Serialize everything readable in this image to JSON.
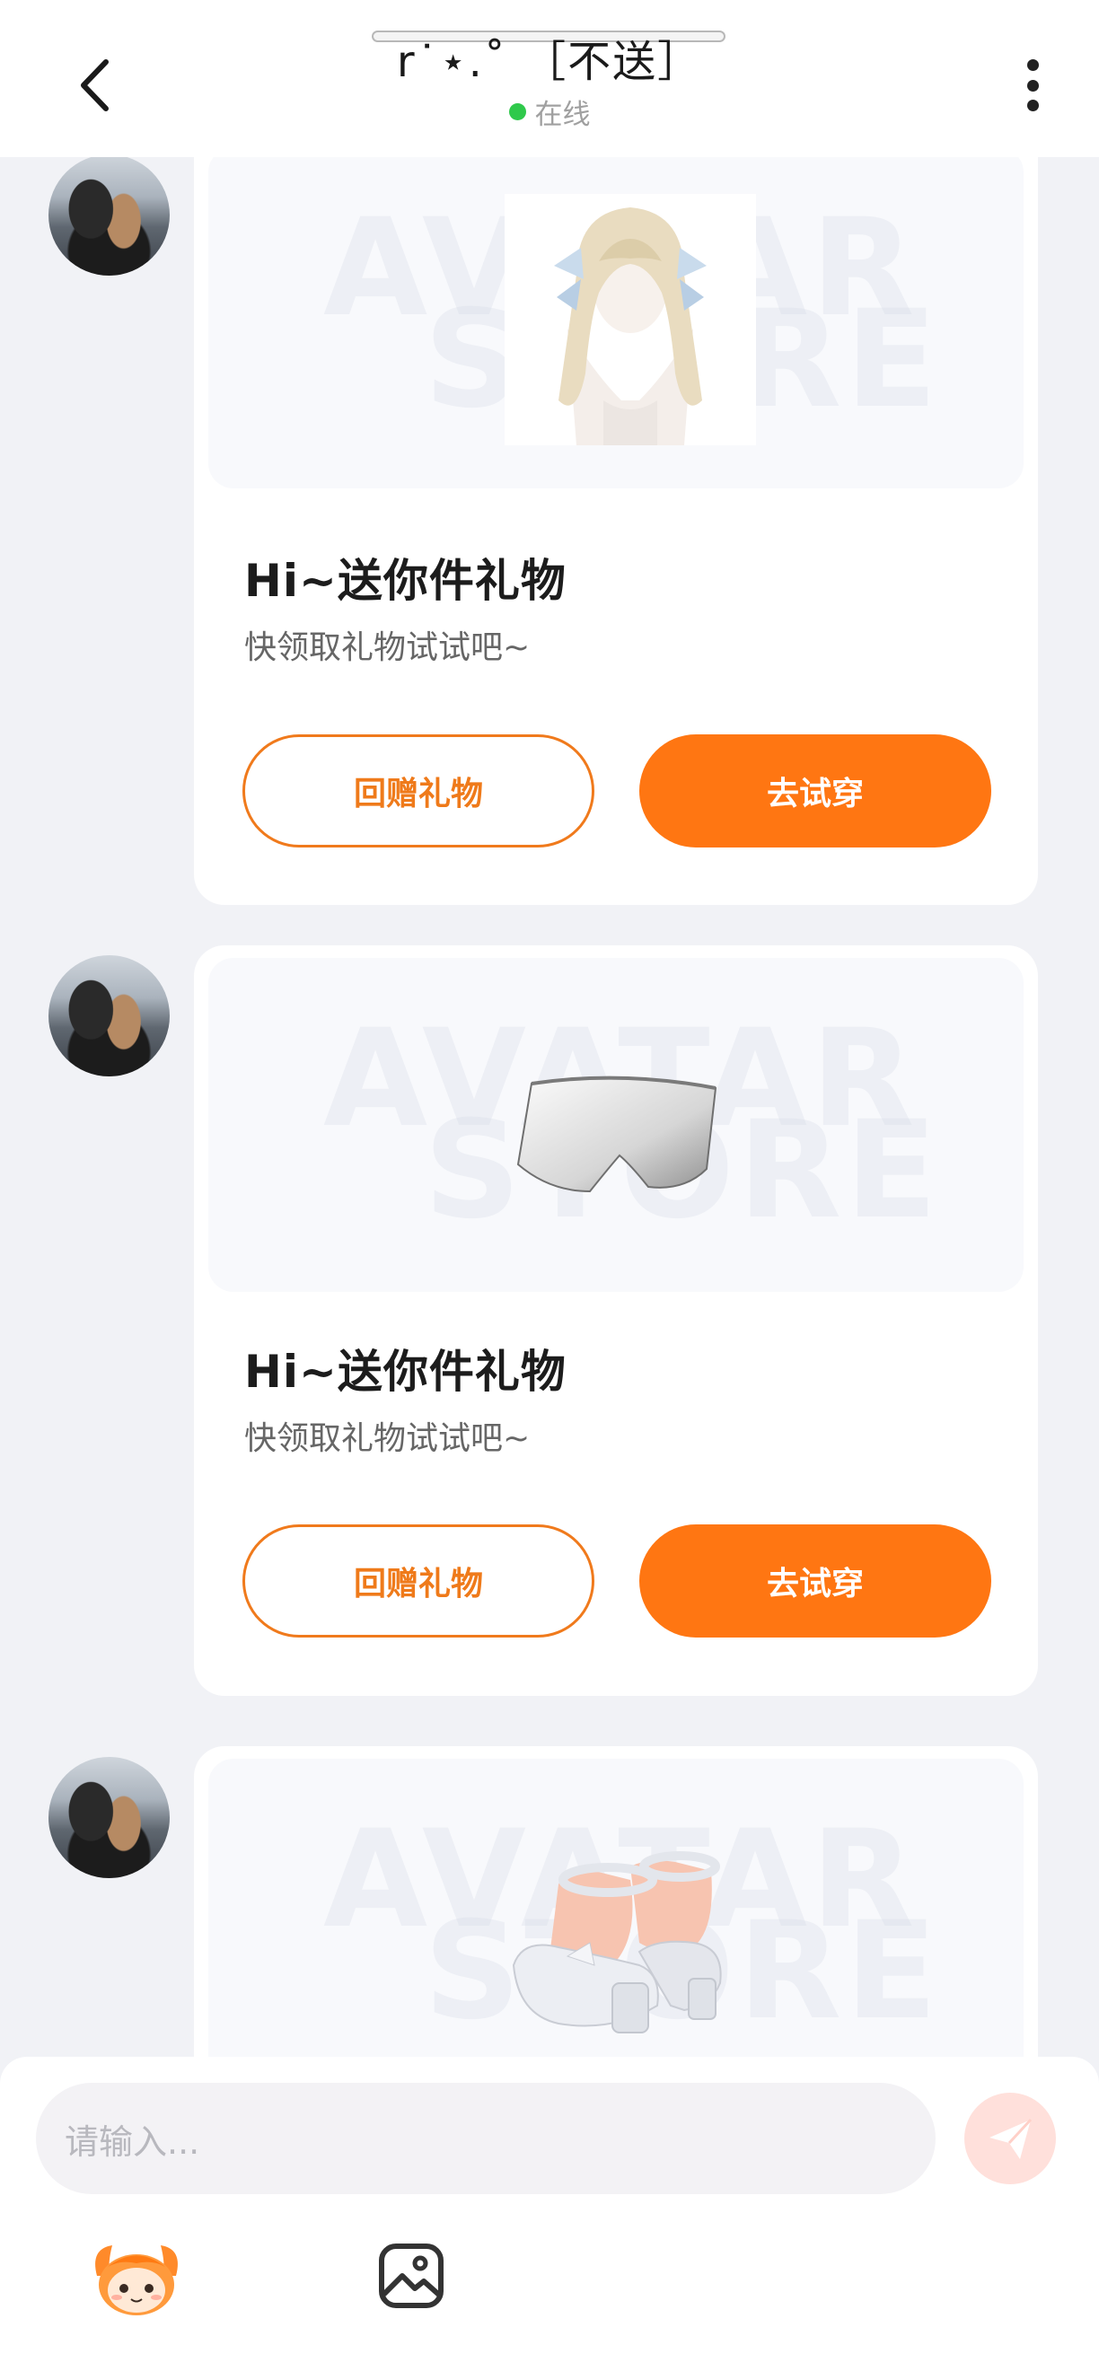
{
  "header": {
    "title": "r˙⋆.˚ ［不送］",
    "status_text": "在线",
    "status_color": "#2fc94b",
    "back_icon": "chevron-left-icon",
    "more_icon": "more-vertical-icon"
  },
  "messages": [
    {
      "item": "hair",
      "title": "Hi~送你件礼物",
      "subtitle": "快领取礼物试试吧~",
      "return_gift_label": "回赠礼物",
      "try_on_label": "去试穿"
    },
    {
      "item": "shorts",
      "title": "Hi~送你件礼物",
      "subtitle": "快领取礼物试试吧~",
      "return_gift_label": "回赠礼物",
      "try_on_label": "去试穿"
    },
    {
      "item": "shoes"
    }
  ],
  "watermark": {
    "line1": "AVATAR",
    "line2": "STORE"
  },
  "composer": {
    "placeholder": "请输入...",
    "send_icon": "send-icon",
    "mascot_icon": "mascot-emoji-icon",
    "image_icon": "image-icon"
  },
  "colors": {
    "accent": "#ff7612",
    "background": "#f1f2f6"
  }
}
